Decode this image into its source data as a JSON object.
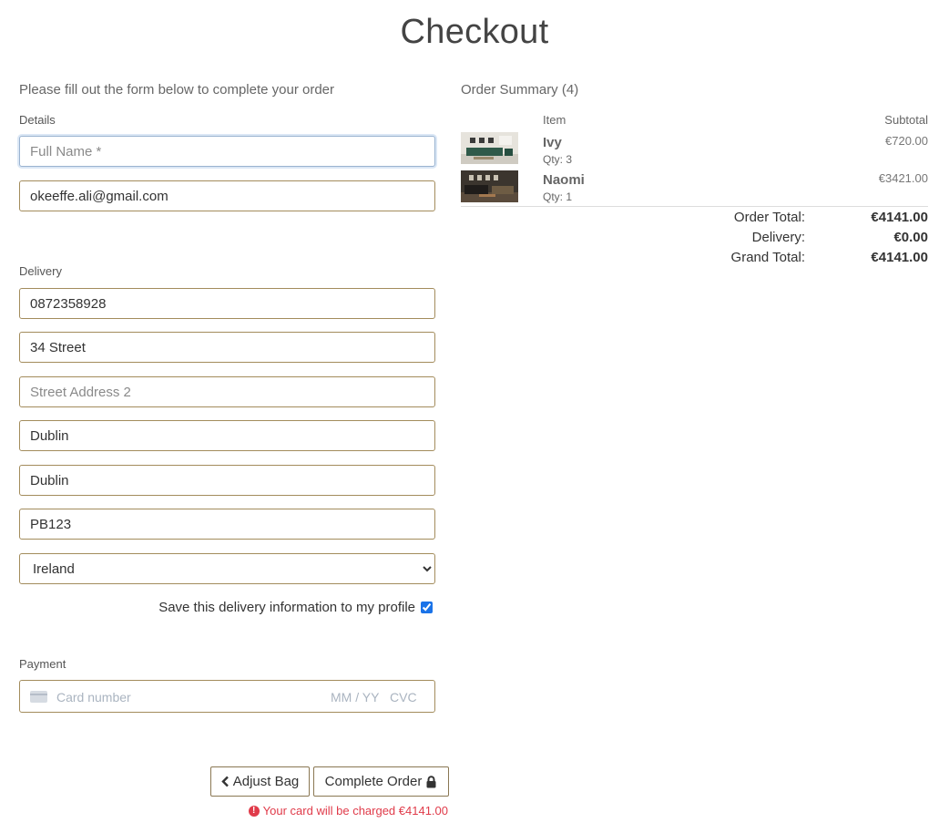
{
  "page": {
    "title": "Checkout"
  },
  "form": {
    "intro": "Please fill out the form below to complete your order",
    "details_label": "Details",
    "full_name_placeholder": "Full Name *",
    "email_value": "okeeffe.ali@gmail.com",
    "delivery_label": "Delivery",
    "phone_value": "0872358928",
    "street1_value": "34 Street",
    "street2_placeholder": "Street Address 2",
    "town_value": "Dublin",
    "county_value": "Dublin",
    "postcode_value": "PB123",
    "country_selected": "Ireland",
    "save_info_label": "Save this delivery information to my profile",
    "save_info_checked": true,
    "payment_label": "Payment",
    "card_placeholder": "Card number",
    "expiry_placeholder": "MM / YY",
    "cvc_placeholder": "CVC"
  },
  "actions": {
    "adjust_bag_label": "Adjust Bag",
    "complete_order_label": "Complete Order",
    "charge_notice": "Your card will be charged €4141.00"
  },
  "summary": {
    "title": "Order Summary (4)",
    "item_header": "Item",
    "subtotal_header": "Subtotal",
    "items": [
      {
        "name": "Ivy",
        "qty": "Qty: 3",
        "subtotal": "€720.00"
      },
      {
        "name": "Naomi",
        "qty": "Qty: 1",
        "subtotal": "€3421.00"
      }
    ],
    "order_total_label": "Order Total:",
    "order_total_value": "€4141.00",
    "delivery_label": "Delivery:",
    "delivery_value": "€0.00",
    "grand_total_label": "Grand Total:",
    "grand_total_value": "€4141.00"
  },
  "colors": {
    "input_border": "#a38c5c",
    "error_red": "#e03b4a",
    "focus_border": "#9ab3d0"
  },
  "icons": {
    "back": "chevron-left-icon",
    "lock": "lock-icon",
    "error": "exclamation-circle-icon",
    "card": "credit-card-icon"
  }
}
